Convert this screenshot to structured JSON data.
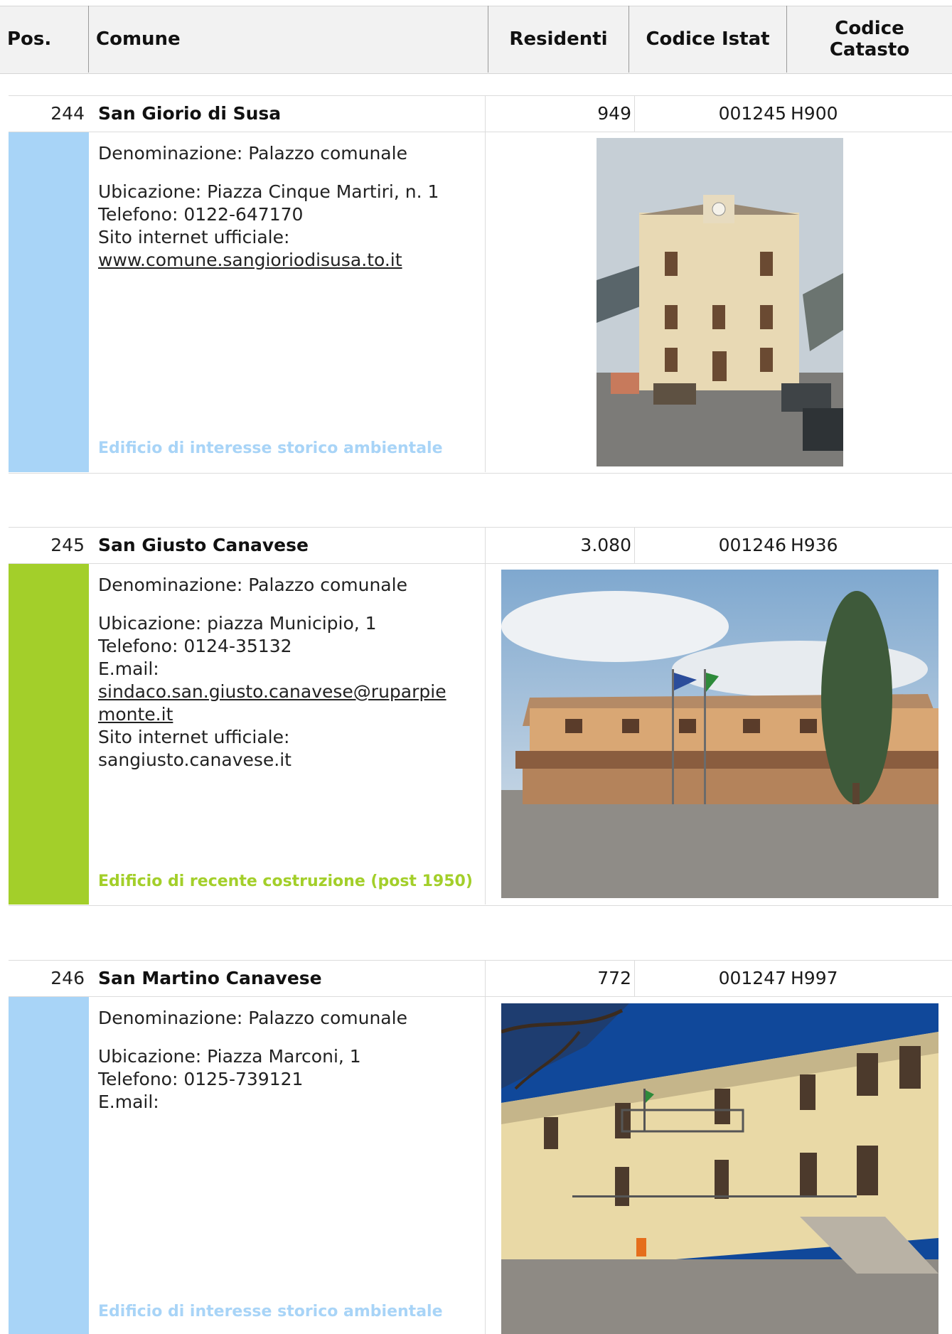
{
  "header": {
    "pos": "Pos.",
    "comune": "Comune",
    "residenti": "Residenti",
    "istat": "Codice Istat",
    "catasto_line1": "Codice",
    "catasto_line2": "Catasto"
  },
  "entries": [
    {
      "pos": "244",
      "comune": "San Giorio di Susa",
      "residenti": "949",
      "istat": "001245",
      "catasto": "H900",
      "denominazione": "Denominazione: Palazzo comunale",
      "ubicazione": "Ubicazione: Piazza Cinque Martiri, n. 1",
      "telefono": "Telefono: 0122-647170",
      "sito_label": "Sito internet ufficiale:",
      "sito": "www.comune.sangioriodisusa.to.it",
      "category": "Edificio di interesse storico ambientale",
      "color": "#a8d4f7"
    },
    {
      "pos": "245",
      "comune": "San Giusto Canavese",
      "residenti": "3.080",
      "istat": "001246",
      "catasto": "H936",
      "denominazione": "Denominazione: Palazzo comunale",
      "ubicazione": "Ubicazione: piazza Municipio, 1",
      "telefono": "Telefono: 0124-35132",
      "email_label": "E.mail:",
      "email_line1": "sindaco.san.giusto.canavese@ruparpie",
      "email_line2": "monte.it",
      "sito_label": "Sito internet ufficiale:",
      "sito": "sangiusto.canavese.it",
      "category": "Edificio di recente costruzione (post 1950)",
      "color": "#a3cf2a"
    },
    {
      "pos": "246",
      "comune": "San Martino Canavese",
      "residenti": "772",
      "istat": "001247",
      "catasto": "H997",
      "denominazione": "Denominazione: Palazzo comunale",
      "ubicazione": "Ubicazione: Piazza Marconi, 1",
      "telefono": "Telefono: 0125-739121",
      "email_label": "E.mail:",
      "category": "Edificio di interesse storico ambientale",
      "color": "#a8d4f7"
    }
  ]
}
